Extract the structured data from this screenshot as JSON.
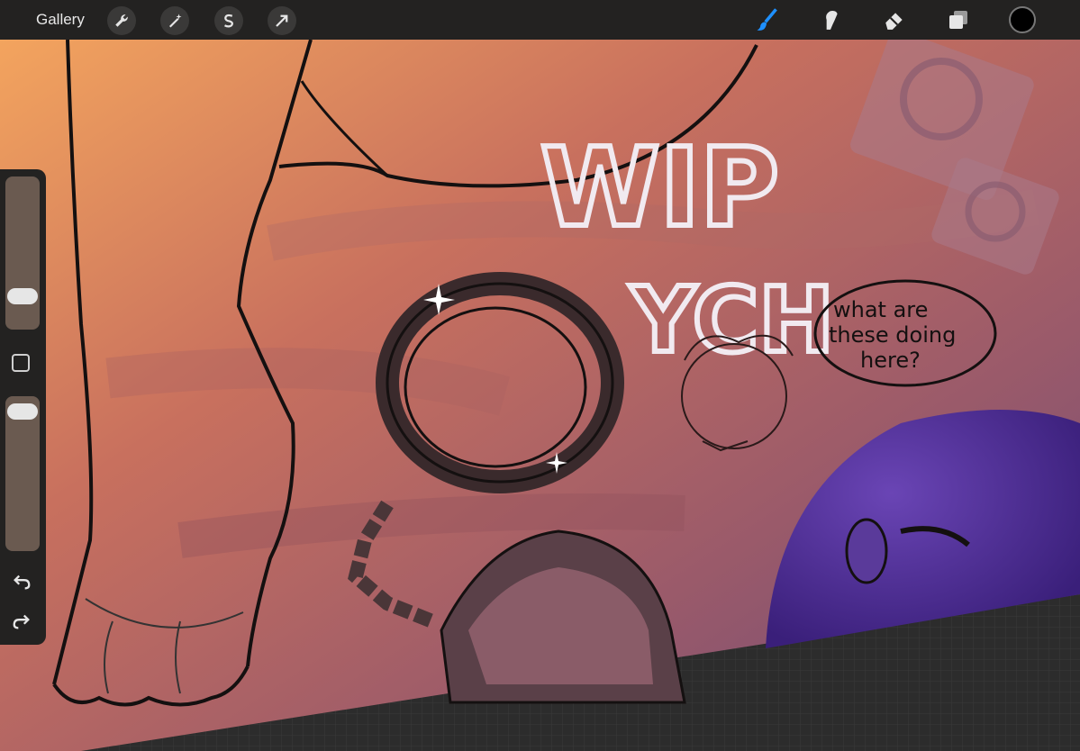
{
  "toolbar": {
    "gallery_label": "Gallery",
    "left_icons": [
      "wrench-icon",
      "magic-wand-icon",
      "selection-s-icon",
      "move-arrow-icon"
    ],
    "right_icons": [
      "brush-icon",
      "smudge-icon",
      "eraser-icon",
      "layers-icon"
    ],
    "brush_color": "#1e90ff",
    "current_color": "#000000"
  },
  "canvas": {
    "wip_text": "WIP",
    "ych_text": "YCH",
    "speech_line1": "what are",
    "speech_line2": "these doing",
    "speech_line3": "here?"
  },
  "sidebar": {
    "size_slider_level": 0.27,
    "opacity_slider_level": 0.9,
    "icons": [
      "modify-square-icon",
      "undo-icon",
      "redo-icon"
    ]
  }
}
